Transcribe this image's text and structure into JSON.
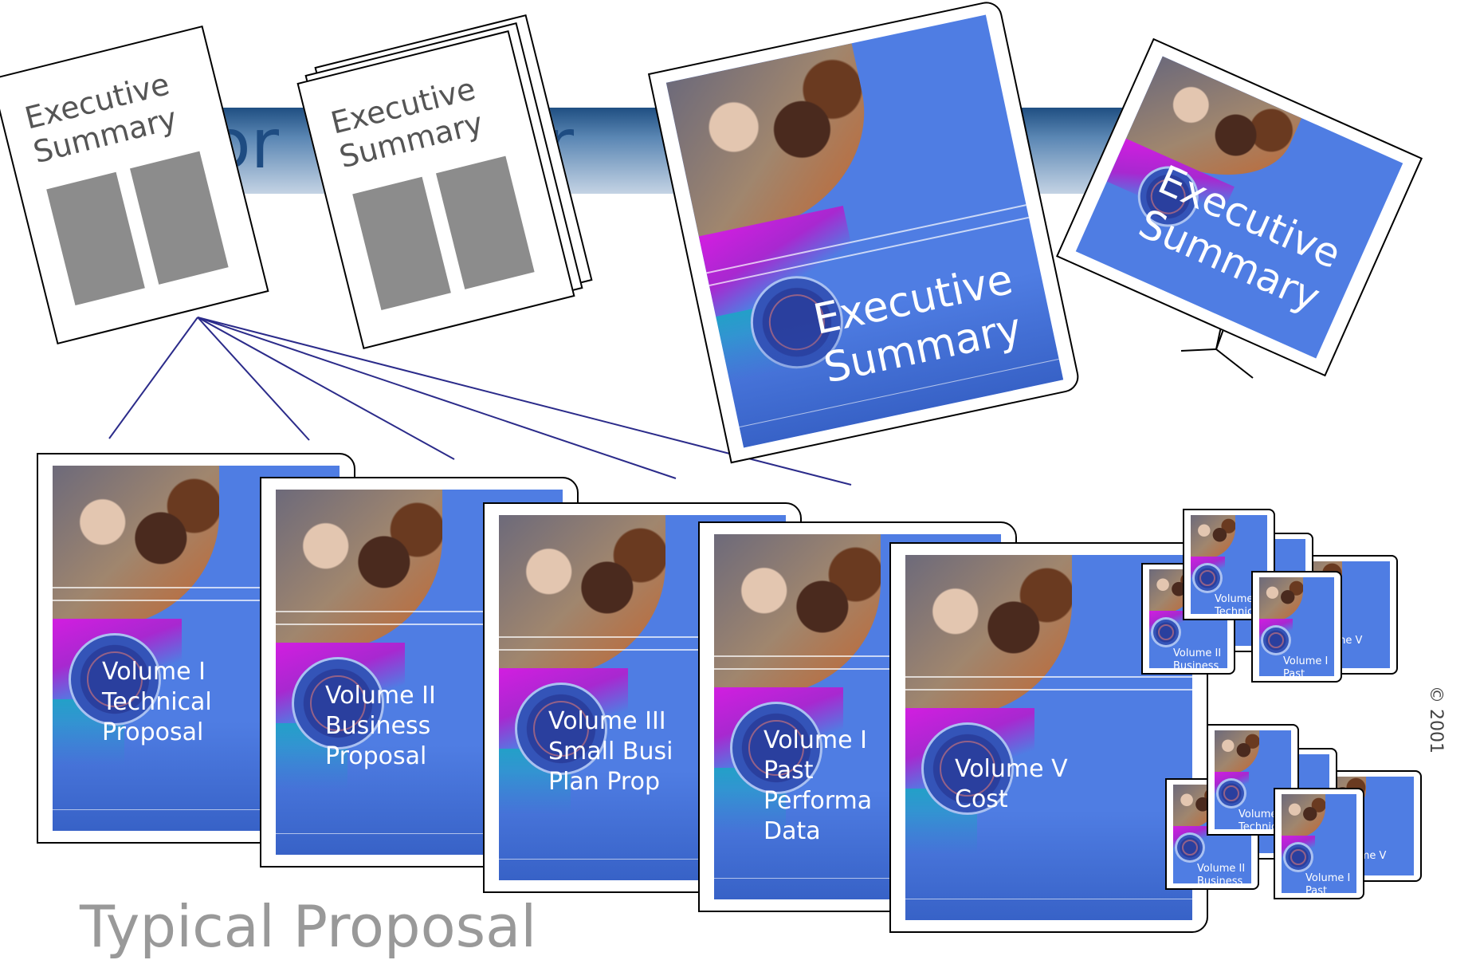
{
  "connector_word": "or",
  "paper_title_line1": "Executive",
  "paper_title_line2": "Summary",
  "exec_summary_title": "Executive\nSummary",
  "volumes": {
    "v1": "Volume I\nTechnical\nProposal",
    "v2": "Volume II\nBusiness\nProposal",
    "v3": "Volume III\nSmall Busi\nPlan Prop",
    "v4": "Volume I\nPast\nPerforma\nData",
    "v5": "Volume V\nCost"
  },
  "mini_labels": {
    "tech": "Volume I\nTechnica\nProposal",
    "business": "Volume II\nBusiness\nProposal",
    "past": "Volume I\nPast\nPerforma",
    "cost": "Volume V\nCost"
  },
  "footer_title": "Typical Proposal",
  "side_caption": "© 2001",
  "colors": {
    "cover_blue": "#4f7de3",
    "band_dark": "#1f4f82",
    "or_text": "#1e4c82",
    "connector_line": "#2b2b8a",
    "gray_block": "#8c8c8c"
  }
}
